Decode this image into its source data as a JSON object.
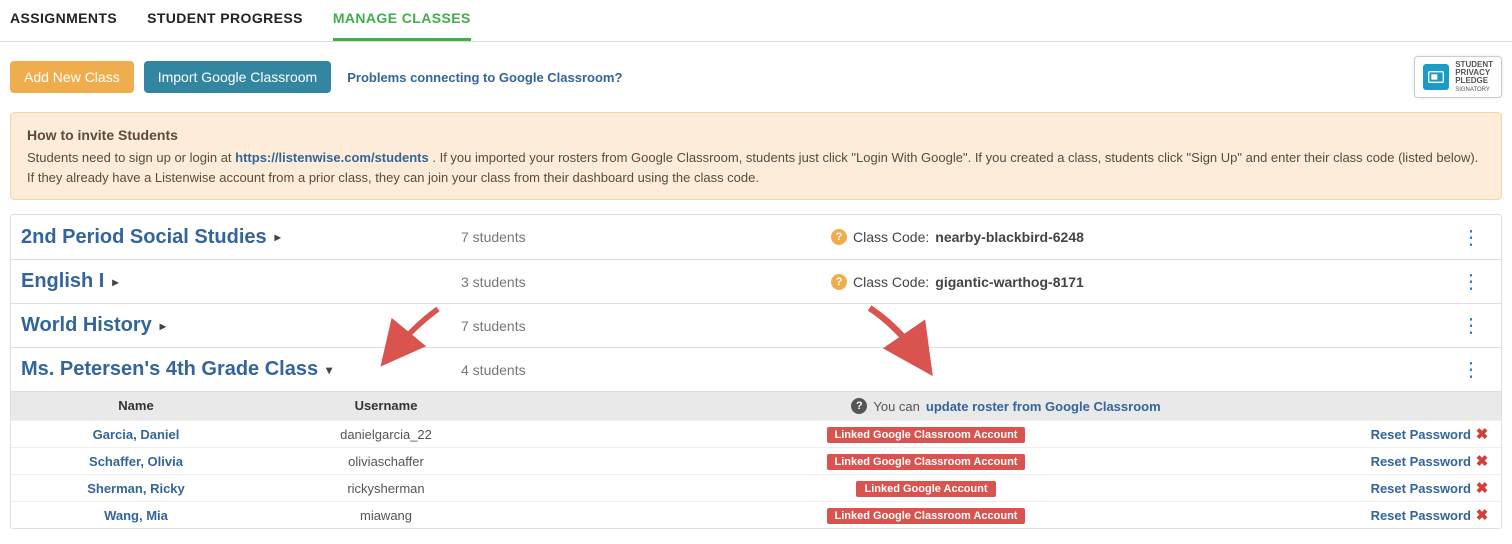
{
  "tabs": {
    "assignments": "ASSIGNMENTS",
    "progress": "STUDENT PROGRESS",
    "manage": "MANAGE CLASSES"
  },
  "toolbar": {
    "add_new_class": "Add New Class",
    "import_google": "Import Google Classroom",
    "problems_link": "Problems connecting to Google Classroom?"
  },
  "privacy_badge": {
    "line1": "STUDENT",
    "line2": "PRIVACY",
    "line3": "PLEDGE",
    "line4": "SIGNATORY"
  },
  "alert": {
    "title": "How to invite Students",
    "body_pre": "Students need to sign up or login at ",
    "link": "https://listenwise.com/students",
    "body_post": " . If you imported your rosters from Google Classroom, students just click \"Login With Google\". If you created a class, students click \"Sign Up\" and enter their class code (listed below). If they already have a Listenwise account from a prior class, they can join your class from their dashboard using the class code."
  },
  "class_code_label": "Class Code: ",
  "classes": [
    {
      "name": "2nd Period Social Studies",
      "students": "7 students",
      "code": "nearby-blackbird-6248",
      "expanded": false
    },
    {
      "name": "English I",
      "students": "3 students",
      "code": "gigantic-warthog-8171",
      "expanded": false
    },
    {
      "name": "World History",
      "students": "7 students",
      "code": "",
      "expanded": false
    },
    {
      "name": "Ms. Petersen's 4th Grade Class",
      "students": "4 students",
      "code": "",
      "expanded": true
    }
  ],
  "roster_header": {
    "name": "Name",
    "username": "Username",
    "update_pre": "You can ",
    "update_link": "update roster from Google Classroom"
  },
  "roster": [
    {
      "name": "Garcia, Daniel",
      "username": "danielgarcia_22",
      "badge": "Linked Google Classroom Account"
    },
    {
      "name": "Schaffer, Olivia",
      "username": "oliviaschaffer",
      "badge": "Linked Google Classroom Account"
    },
    {
      "name": "Sherman, Ricky",
      "username": "rickysherman",
      "badge": "Linked Google Account"
    },
    {
      "name": "Wang, Mia",
      "username": "miawang",
      "badge": "Linked Google Classroom Account"
    }
  ],
  "reset_password": "Reset Password"
}
